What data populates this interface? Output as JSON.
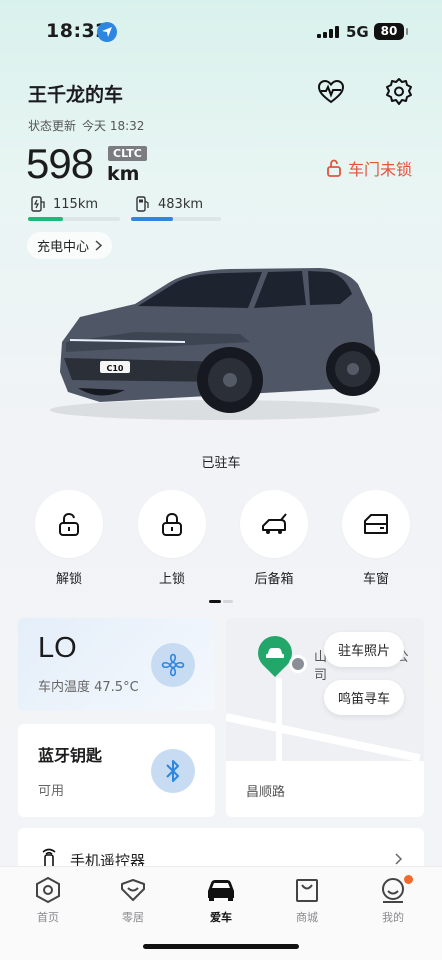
{
  "status_bar": {
    "time": "18:32",
    "network": "5G",
    "battery": "80"
  },
  "header": {
    "car_title": "王千龙的车",
    "update_label": "状态更新",
    "update_time": "今天 18:32",
    "health_icon": "heart-pulse-icon",
    "settings_icon": "gear-icon"
  },
  "range": {
    "value": "598",
    "unit": "km",
    "standard": "CLTC",
    "electric": "115km",
    "fuel": "483km",
    "electric_level": 0.38,
    "fuel_level": 0.47
  },
  "door_status": "车门未锁",
  "charge_center": "充电中心",
  "car_state": "已驻车",
  "actions": [
    {
      "label": "解锁",
      "icon": "unlock-icon"
    },
    {
      "label": "上锁",
      "icon": "lock-icon"
    },
    {
      "label": "后备箱",
      "icon": "trunk-icon"
    },
    {
      "label": "车窗",
      "icon": "window-icon"
    }
  ],
  "climate": {
    "setting": "LO",
    "cabin_label": "车内温度 47.5°C",
    "icon": "fan-icon"
  },
  "bluetooth_key": {
    "title": "蓝牙钥匙",
    "status": "可用",
    "icon": "bluetooth-icon"
  },
  "map": {
    "poi_text": "山... 车业有限公司",
    "photo_btn": "驻车照片",
    "horn_btn": "鸣笛寻车",
    "address": "昌顺路"
  },
  "remote": {
    "title": "手机遥控器",
    "icon": "remote-icon"
  },
  "tabbar": [
    {
      "label": "首页",
      "icon": "hexagon-icon",
      "active": false
    },
    {
      "label": "零居",
      "icon": "heart-outline-icon",
      "active": false
    },
    {
      "label": "爱车",
      "icon": "car-icon",
      "active": true
    },
    {
      "label": "商城",
      "icon": "shopping-bag-icon",
      "active": false
    },
    {
      "label": "我的",
      "icon": "profile-icon",
      "active": false
    }
  ],
  "colors": {
    "accent_green": "#1fb87a",
    "accent_blue": "#2d86e0",
    "warning_red": "#e5533e"
  }
}
